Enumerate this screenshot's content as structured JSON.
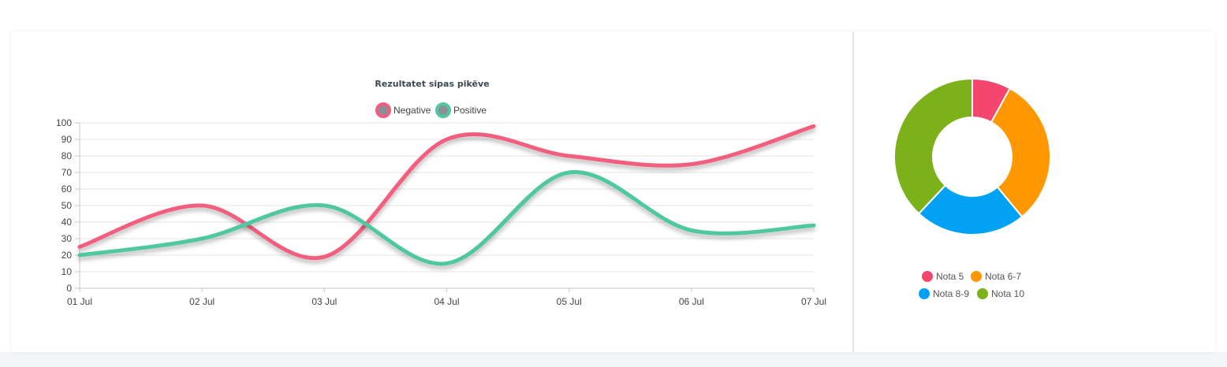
{
  "chart_data": [
    {
      "type": "line",
      "title": "Rezultatet sipas pikëve",
      "xlabel": "",
      "ylabel": "",
      "categories": [
        "01 Jul",
        "02 Jul",
        "03 Jul",
        "04 Jul",
        "05 Jul",
        "06 Jul",
        "07 Jul"
      ],
      "ylim": [
        0,
        100
      ],
      "yticks": [
        0,
        10,
        20,
        30,
        40,
        50,
        60,
        70,
        80,
        90,
        100
      ],
      "grid": true,
      "legend_position": "top",
      "series": [
        {
          "name": "Negative",
          "color": "#f25f7e",
          "values": [
            25,
            50,
            19,
            90,
            80,
            75,
            98
          ]
        },
        {
          "name": "Positive",
          "color": "#4fc8a0",
          "values": [
            20,
            30,
            50,
            15,
            70,
            35,
            38
          ]
        }
      ]
    },
    {
      "type": "pie",
      "variant": "donut",
      "legend_position": "bottom",
      "categories": [
        "Nota 5",
        "Nota 6-7",
        "Nota 8-9",
        "Nota 10"
      ],
      "values": [
        8,
        31,
        23,
        38
      ],
      "colors": [
        "#f5466f",
        "#ff9800",
        "#03a1f4",
        "#7cb11a"
      ]
    }
  ]
}
